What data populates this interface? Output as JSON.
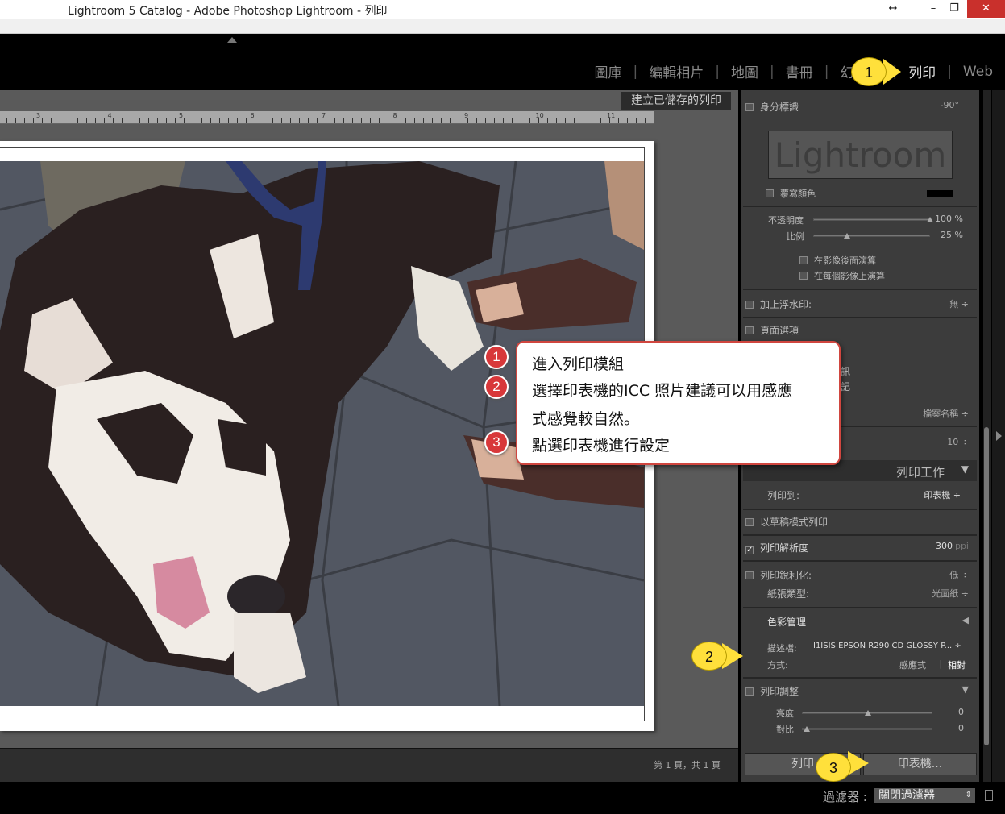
{
  "window": {
    "title": "Lightroom 5 Catalog - Adobe Photoshop Lightroom - 列印",
    "btn_resize": "↔",
    "btn_min": "–",
    "btn_max": "❐",
    "btn_close": "✕"
  },
  "modules": [
    "圖庫",
    "編輯相片",
    "地圖",
    "書冊",
    "幻燈片",
    "列印",
    "Web"
  ],
  "active_module": "列印",
  "save_print_label": "建立已儲存的列印",
  "ruler_numbers": [
    "3",
    "4",
    "5",
    "6",
    "7",
    "8",
    "9",
    "10",
    "11"
  ],
  "page_count": "第 1 頁，共 1 頁",
  "filter": {
    "label": "過濾器 :",
    "value": "關閉過濾器"
  },
  "identity": {
    "label": "身分標識",
    "angle": "-90°",
    "plate_text": "Lightroom",
    "override_color": "覆寫顏色",
    "opacity_label": "不透明度",
    "opacity_value": "100 %",
    "opacity": 1.0,
    "scale_label": "比例",
    "scale_value": "25 %",
    "scale": 0.25,
    "render_behind": "在影像後面演算",
    "render_each": "在每個影像上演算"
  },
  "watermark": {
    "label": "加上浮水印:",
    "value": "無 ÷"
  },
  "page_options": {
    "label": "頁面選項",
    "partial1": "訊",
    "partial2": "記"
  },
  "filename_row": {
    "value": "檔案名稱 ÷"
  },
  "size_row": {
    "value": "10 ÷"
  },
  "print_job": {
    "header": "列印工作",
    "print_to_label": "列印到:",
    "print_to_value": "印表機 ÷",
    "draft_mode": "以草稿模式列印",
    "resolution_label": "列印解析度",
    "resolution_value": "300",
    "resolution_unit": "ppi",
    "sharpen_label": "列印銳利化:",
    "sharpen_value": "低 ÷",
    "paper_label": "紙張類型:",
    "paper_value": "光面紙 ÷",
    "color_mgmt": "色彩管理",
    "profile_label": "描述檔:",
    "profile_value": "I1ISIS EPSON R290 CD GLOSSY P... ÷",
    "intent_label": "方式:",
    "intent_perceptual": "感應式",
    "intent_relative": "相對",
    "adjust_label": "列印調整",
    "brightness_label": "亮度",
    "brightness_value": "0",
    "contrast_label": "對比",
    "contrast_value": "0"
  },
  "buttons": {
    "print": "列印",
    "printer": "印表機..."
  },
  "callouts": [
    "1",
    "2",
    "3"
  ],
  "note": {
    "nums": [
      "1",
      "2",
      "3"
    ],
    "line1": "進入列印模組",
    "line2": "選擇印表機的ICC 照片建議可以用感應",
    "line2b": "式感覺較自然。",
    "line3": "點選印表機進行設定"
  }
}
